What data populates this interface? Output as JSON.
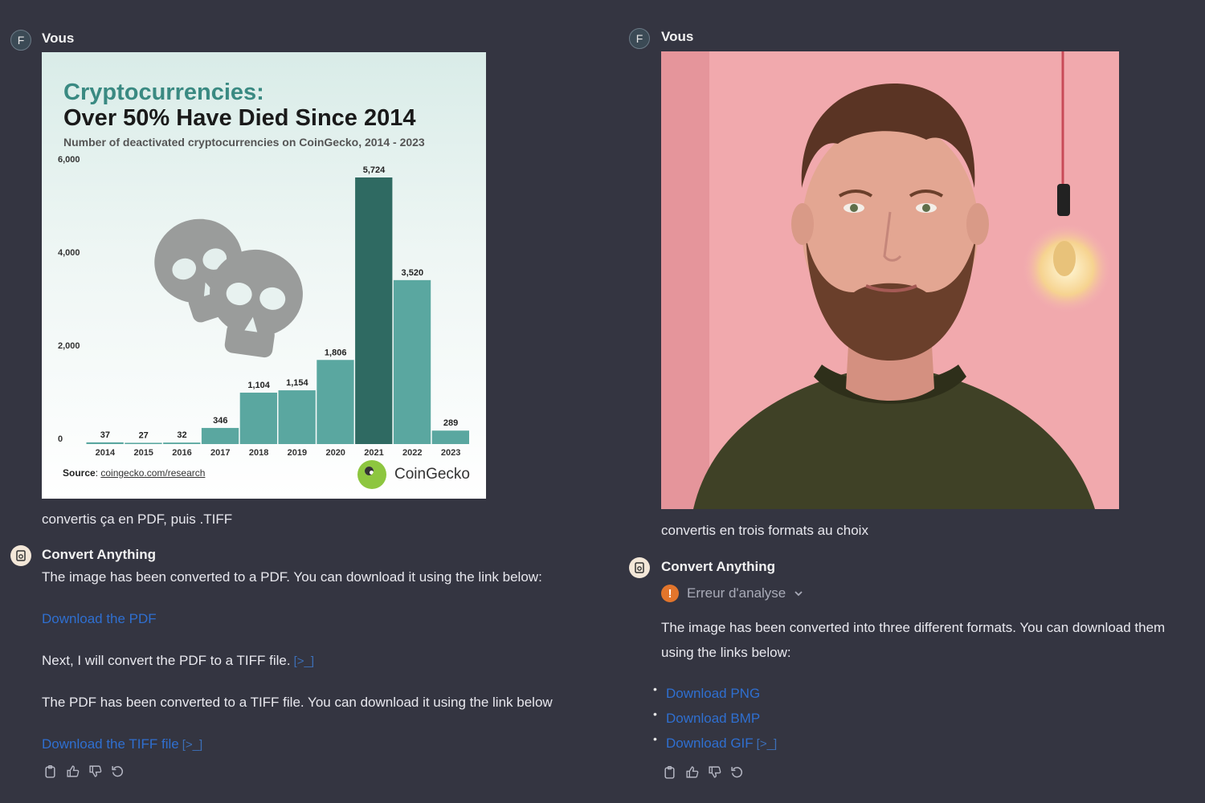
{
  "left": {
    "user_avatar": "F",
    "user_name": "Vous",
    "user_message": "convertis ça en PDF, puis .TIFF",
    "assistant_name": "Convert Anything",
    "p1": "The image has been converted to a PDF. You can download it using the link below:",
    "link_pdf": "Download the PDF",
    "p2": "Next, I will convert the PDF to a TIFF file.",
    "p3": "The PDF has been converted to a TIFF file. You can download it using the link below",
    "link_tiff": "Download the TIFF file",
    "sandbox_glyph": "[>_]"
  },
  "right": {
    "user_avatar": "F",
    "user_name": "Vous",
    "user_message": "convertis en trois formats au choix",
    "assistant_name": "Convert Anything",
    "error_label": "Erreur d'analyse",
    "error_glyph": "!",
    "p1": "The image has been converted into three different formats. You can download them using the links below:",
    "links": [
      "Download PNG",
      "Download BMP",
      "Download GIF"
    ],
    "sandbox_glyph": "[>_]"
  },
  "chart_data": {
    "type": "bar",
    "title_line1": "Cryptocurrencies:",
    "title_line2": "Over 50% Have Died Since 2014",
    "subtitle": "Number of deactivated cryptocurrencies on CoinGecko, 2014 - 2023",
    "categories": [
      "2014",
      "2015",
      "2016",
      "2017",
      "2018",
      "2019",
      "2020",
      "2021",
      "2022",
      "2023"
    ],
    "values": [
      37,
      27,
      32,
      346,
      1104,
      1154,
      1806,
      5724,
      3520,
      289
    ],
    "value_labels": [
      "37",
      "27",
      "32",
      "346",
      "1,104",
      "1,154",
      "1,806",
      "5,724",
      "3,520",
      "289"
    ],
    "ylim": [
      0,
      6000
    ],
    "yticks": [
      0,
      2000,
      4000,
      6000
    ],
    "ytick_labels": [
      "0",
      "2,000",
      "4,000",
      "6,000"
    ],
    "source_label": "Source",
    "source_link": "coingecko.com/research",
    "brand": "CoinGecko",
    "colors": {
      "bar": "#5aa7a0",
      "highlight": "#2f6a62",
      "skull": "#9a9c9b"
    },
    "highlight_index": 7
  }
}
